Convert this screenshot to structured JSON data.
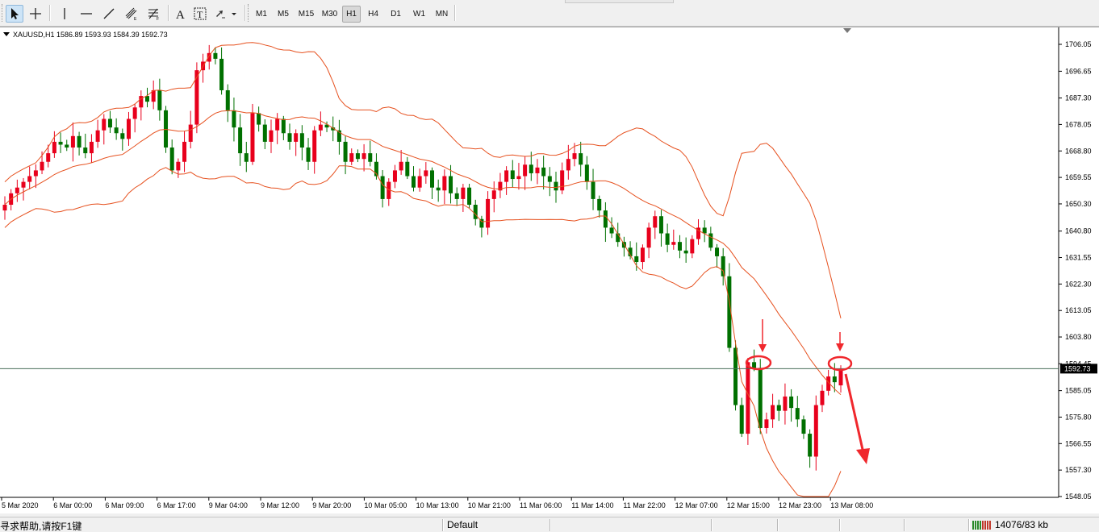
{
  "chart": {
    "symbol_info": "XAUUSD,H1  1586.89 1593.93 1584.39 1592.73",
    "current_price_label": "1592.73",
    "price_axis_labels": [
      "1706.05",
      "1696.65",
      "1687.30",
      "1678.05",
      "1668.80",
      "1659.55",
      "1650.30",
      "1640.80",
      "1631.55",
      "1622.30",
      "1613.05",
      "1603.80",
      "1594.45",
      "1585.05",
      "1575.80",
      "1566.55",
      "1557.30",
      "1548.05"
    ],
    "time_axis_labels": [
      "5 Mar 2020",
      "6 Mar 00:00",
      "6 Mar 09:00",
      "6 Mar 17:00",
      "9 Mar 04:00",
      "9 Mar 12:00",
      "9 Mar 20:00",
      "10 Mar 05:00",
      "10 Mar 13:00",
      "10 Mar 21:00",
      "11 Mar 06:00",
      "11 Mar 14:00",
      "11 Mar 22:00",
      "12 Mar 07:00",
      "12 Mar 15:00",
      "12 Mar 23:00",
      "13 Mar 08:00"
    ],
    "colors": {
      "bull": "#e8001c",
      "bear": "#007000",
      "band": "#e6501e",
      "annotation": "#f0282d",
      "price_line": "#4a6e5a"
    }
  },
  "chart_data": {
    "type": "candlestick",
    "symbol": "XAUUSD",
    "timeframe": "H1",
    "last_bar": {
      "open": 1586.89,
      "high": 1593.93,
      "low": 1584.39,
      "close": 1592.73
    },
    "ylim": [
      1548.05,
      1706.05
    ],
    "indicators": [
      "Bollinger Bands"
    ],
    "annotations": [
      "resistance-circle-1",
      "resistance-circle-2",
      "down-arrow-1",
      "down-arrow-2",
      "trend-down-arrow"
    ],
    "candles_close": [
      1650,
      1654,
      1656,
      1658,
      1660,
      1662,
      1665,
      1668,
      1672,
      1671,
      1670,
      1674,
      1670,
      1668,
      1672,
      1676,
      1680,
      1677,
      1675,
      1673,
      1680,
      1684,
      1688,
      1686,
      1690,
      1683,
      1670,
      1662,
      1665,
      1672,
      1678,
      1697,
      1700,
      1703,
      1701,
      1690,
      1683,
      1677,
      1668,
      1665,
      1682,
      1678,
      1672,
      1676,
      1680,
      1675,
      1672,
      1675,
      1670,
      1665,
      1676,
      1678,
      1677,
      1676,
      1672,
      1665,
      1668,
      1666,
      1668,
      1665,
      1660,
      1652,
      1658,
      1662,
      1665,
      1660,
      1656,
      1660,
      1662,
      1656,
      1655,
      1660,
      1654,
      1652,
      1656,
      1650,
      1645,
      1642,
      1652,
      1655,
      1658,
      1662,
      1659,
      1660,
      1664,
      1661,
      1663,
      1660,
      1658,
      1655,
      1662,
      1666,
      1668,
      1664,
      1658,
      1652,
      1648,
      1642,
      1640,
      1637,
      1635,
      1632,
      1630,
      1635,
      1642,
      1646,
      1640,
      1636,
      1637,
      1634,
      1633,
      1638,
      1642,
      1640,
      1635,
      1632,
      1625,
      1600,
      1580,
      1570,
      1595,
      1593,
      1572,
      1575,
      1580,
      1578,
      1583,
      1579,
      1575,
      1570,
      1562,
      1580,
      1585,
      1590,
      1588,
      1592.73
    ]
  },
  "status": {
    "help_text": "寻求帮助,请按F1键",
    "profile": "Default",
    "traffic": "14076/83 kb"
  },
  "toolbar": {
    "timeframes": [
      "M1",
      "M5",
      "M15",
      "M30",
      "H1",
      "H4",
      "D1",
      "W1",
      "MN"
    ],
    "active_timeframe": "H1"
  }
}
